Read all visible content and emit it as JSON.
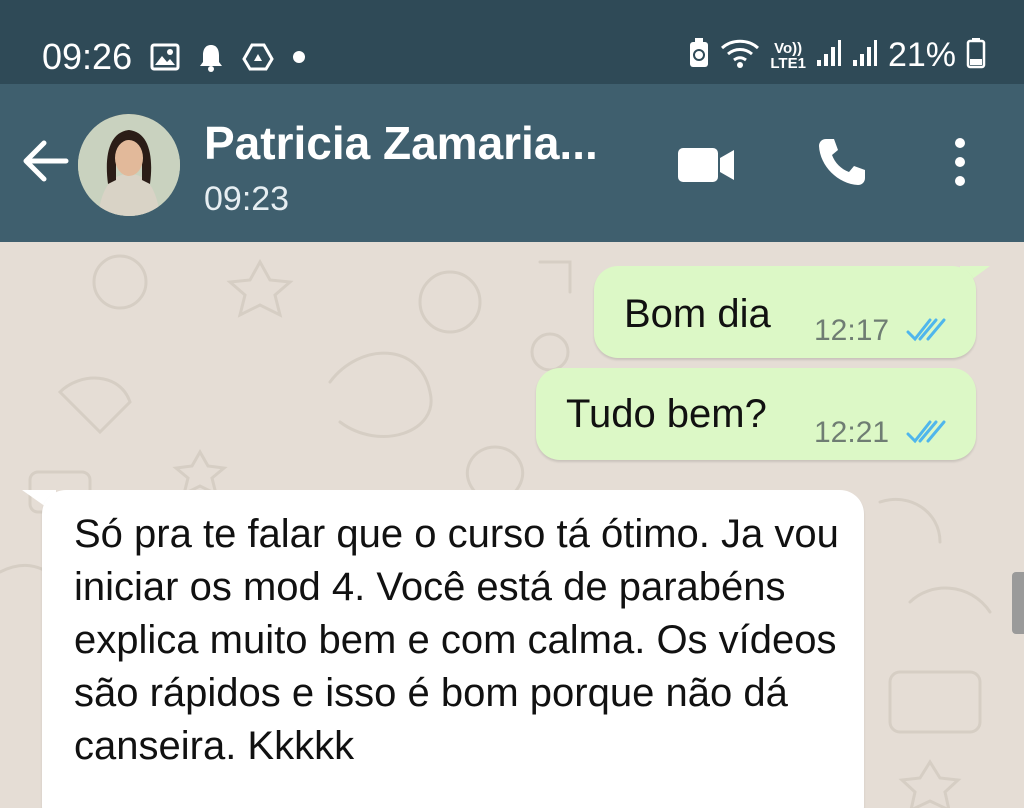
{
  "status_bar": {
    "time": "09:26",
    "battery_percent": "21%",
    "network_label_top": "Vo))",
    "network_label_bottom": "LTE1",
    "left_icons": [
      "image-icon",
      "bell-icon",
      "drive-icon",
      "dot-icon"
    ],
    "right_icons": [
      "battery-saver-icon",
      "wifi-icon",
      "volte-icon",
      "signal-icon",
      "signal-icon",
      "battery-icon"
    ]
  },
  "header": {
    "contact_name": "Patricia Zamaria...",
    "last_seen": "09:23",
    "icons": [
      "back-arrow-icon",
      "video-call-icon",
      "phone-call-icon",
      "more-vert-icon"
    ]
  },
  "chat": {
    "messages": [
      {
        "direction": "outgoing",
        "text": "Bom dia",
        "time": "12:17",
        "status": "read"
      },
      {
        "direction": "outgoing",
        "text": "Tudo bem?",
        "time": "12:21",
        "status": "read"
      },
      {
        "direction": "incoming",
        "text": "Só pra te falar que o curso tá ótimo. Ja vou iniciar os mod 4. Você está de parabéns explica muito bem e com calma. Os vídeos são rápidos e isso é bom porque não dá canseira. Kkkkk"
      }
    ]
  },
  "colors": {
    "status_bar_bg": "#2F4A57",
    "header_bg": "#3F5F6E",
    "outgoing_bubble": "#DCF8C6",
    "incoming_bubble": "#FFFFFF",
    "read_ticks": "#4FB6EC",
    "chat_bg": "#E5DDD5"
  }
}
